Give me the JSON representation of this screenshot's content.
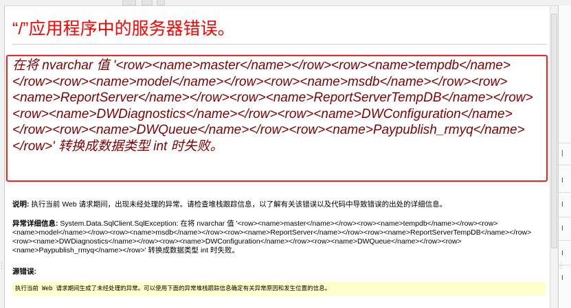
{
  "page": {
    "title": "“/”应用程序中的服务器错误。",
    "error_message": "在将 nvarchar 值 '<row><name>master</name></row><row><name>tempdb</name></row><row><name>model</name></row><row><name>msdb</name></row><row><name>ReportServer</name></row><row><name>ReportServerTempDB</name></row><row><name>DWDiagnostics</name></row><row><name>DWConfiguration</name></row><row><name>DWQueue</name></row><row><name>Paypublish_rmyq</name></row>' 转换成数据类型 int 时失败。",
    "description_label": "说明:",
    "description_text": " 执行当前 Web 请求期间，出现未经处理的异常。请检查堆栈跟踪信息，以了解有关该错误以及代码中导致错误的出处的详细信息。",
    "exception_label": "异常详细信息:",
    "exception_text": " System.Data.SqlClient.SqlException: 在将 nvarchar 值 '<row><name>master</name></row><row><name>tempdb</name></row><row><name>model</name></row><row><name>msdb</name></row><row><name>ReportServer</name></row><row><name>ReportServerTempDB</name></row><row><name>DWDiagnostics</name></row><row><name>DWConfiguration</name></row><row><name>DWQueue</name></row><row><name>Paypublish_rmyq</name></row>' 转换成数据类型 int 时失败。",
    "source_error_label": "源错误:",
    "source_error_text": "执行当前 Web 请求期间生成了未经处理的异常。可以使用下面的异常堆栈跟踪信息确定有关异常原因和发生位置的信息。"
  },
  "colors": {
    "title": "#ff0000",
    "error_message": "#800000",
    "highlight_border": "#e52a2a",
    "source_box_bg": "#ffffcc"
  }
}
